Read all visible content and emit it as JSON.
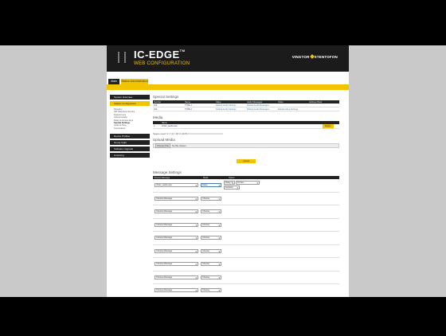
{
  "header": {
    "title": "IC-EDGE",
    "tm": "TM",
    "subtitle": "WEB CONFIGURATION",
    "brand_left": "VINGTOR",
    "brand_right": "STENTOFON"
  },
  "tabs": [
    {
      "label": "Main"
    },
    {
      "label": "Station Administration"
    }
  ],
  "sidebar": {
    "items": [
      {
        "label": "System Overview"
      },
      {
        "label": "Station Configuration"
      }
    ],
    "subitems": [
      "Directory",
      "SIP Telephone Service",
      "Feature keys",
      "Call and Audio",
      "Relay & Access keys",
      "Special Settings",
      "Audio & Tone",
      "Connections"
    ],
    "items2": [
      {
        "label": "Device Profiles"
      },
      {
        "label": "Group Calls"
      },
      {
        "label": "Software Upgrade"
      },
      {
        "label": "Licensing"
      }
    ]
  },
  "special": {
    "heading": "Special Settings",
    "columns": [
      "Number",
      "Name",
      "Value",
      "Audio Messages",
      "Video",
      "Address Book"
    ],
    "rows": [
      [
        "101",
        "TYPE 1",
        "Default Audio Settings",
        "Default Audio Messages",
        "",
        ""
      ],
      [
        "102",
        "TYPE 2",
        "Default Audio Settings",
        "Default Audio Messages",
        "Default video Settings",
        ""
      ]
    ]
  },
  "media": {
    "heading": "Media",
    "columns": [
      "Name"
    ],
    "rows": [
      {
        "num": "1",
        "name": "Video_audio.wav",
        "action": "Delete"
      }
    ],
    "note": "Space used: 0.7 (1) / 48.0 (19 B)"
  },
  "upload": {
    "heading": "Upload Media",
    "file_button": "Choose File",
    "file_status": "No file chosen",
    "upload_button": "Upload"
  },
  "message": {
    "heading": "Message Settings",
    "columns": [
      "Choose Message",
      "Mode",
      "Option"
    ],
    "rows": [
      {
        "message": "Video_audio.wav",
        "mode": "Delay",
        "opt1": "Delay 1",
        "opt1val": "10 Sec",
        "opt2": "Duration"
      },
      {
        "message": "Choose Message",
        "mode": "Choose"
      },
      {
        "message": "Choose Message",
        "mode": "Choose"
      },
      {
        "message": "Choose Message",
        "mode": "Choose"
      },
      {
        "message": "Choose Message",
        "mode": "Choose"
      },
      {
        "message": "Choose Message",
        "mode": "Choose"
      },
      {
        "message": "Choose Message",
        "mode": "Choose"
      },
      {
        "message": "Choose Message",
        "mode": "Choose"
      },
      {
        "message": "Choose Message",
        "mode": "Choose"
      }
    ]
  },
  "colors": {
    "accent": "#f2c400",
    "dark": "#222222",
    "link": "#4a7aa8"
  }
}
